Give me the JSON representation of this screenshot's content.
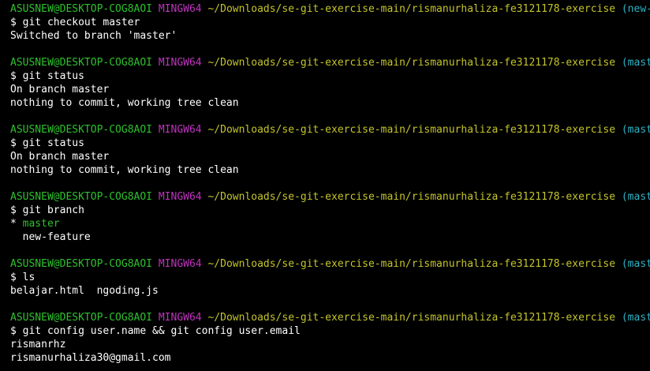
{
  "colors": {
    "background": "#000000",
    "user_host": "#2ec12e",
    "shell": "#bf33bf",
    "path": "#c4c42b",
    "branch": "#2bb3c4",
    "text": "#ffffff",
    "current_branch": "#2ec12e"
  },
  "blocks": [
    {
      "prompt": {
        "user_host": "ASUSNEW@DESKTOP-COG8AOI",
        "shell": "MINGW64",
        "path": "~/Downloads/se-git-exercise-main/rismanurhaliza-fe3121178-exercise",
        "branch": "(new-feature)"
      },
      "command": "$ git checkout master",
      "output": [
        "Switched to branch 'master'"
      ]
    },
    {
      "prompt": {
        "user_host": "ASUSNEW@DESKTOP-COG8AOI",
        "shell": "MINGW64",
        "path": "~/Downloads/se-git-exercise-main/rismanurhaliza-fe3121178-exercise",
        "branch": "(master)"
      },
      "command": "$ git status",
      "output": [
        "On branch master",
        "nothing to commit, working tree clean"
      ]
    },
    {
      "prompt": {
        "user_host": "ASUSNEW@DESKTOP-COG8AOI",
        "shell": "MINGW64",
        "path": "~/Downloads/se-git-exercise-main/rismanurhaliza-fe3121178-exercise",
        "branch": "(master)"
      },
      "command": "$ git status",
      "output": [
        "On branch master",
        "nothing to commit, working tree clean"
      ]
    },
    {
      "prompt": {
        "user_host": "ASUSNEW@DESKTOP-COG8AOI",
        "shell": "MINGW64",
        "path": "~/Downloads/se-git-exercise-main/rismanurhaliza-fe3121178-exercise",
        "branch": "(master)"
      },
      "command": "$ git branch",
      "branch_list": {
        "marker": "* ",
        "current": "master",
        "others": [
          "  new-feature"
        ]
      }
    },
    {
      "prompt": {
        "user_host": "ASUSNEW@DESKTOP-COG8AOI",
        "shell": "MINGW64",
        "path": "~/Downloads/se-git-exercise-main/rismanurhaliza-fe3121178-exercise",
        "branch": "(master)"
      },
      "command": "$ ls",
      "output": [
        "belajar.html  ngoding.js"
      ]
    },
    {
      "prompt": {
        "user_host": "ASUSNEW@DESKTOP-COG8AOI",
        "shell": "MINGW64",
        "path": "~/Downloads/se-git-exercise-main/rismanurhaliza-fe3121178-exercise",
        "branch": "(master)"
      },
      "command": "$ git config user.name && git config user.email",
      "output": [
        "rismanrhz",
        "rismanurhaliza30@gmail.com"
      ]
    }
  ]
}
